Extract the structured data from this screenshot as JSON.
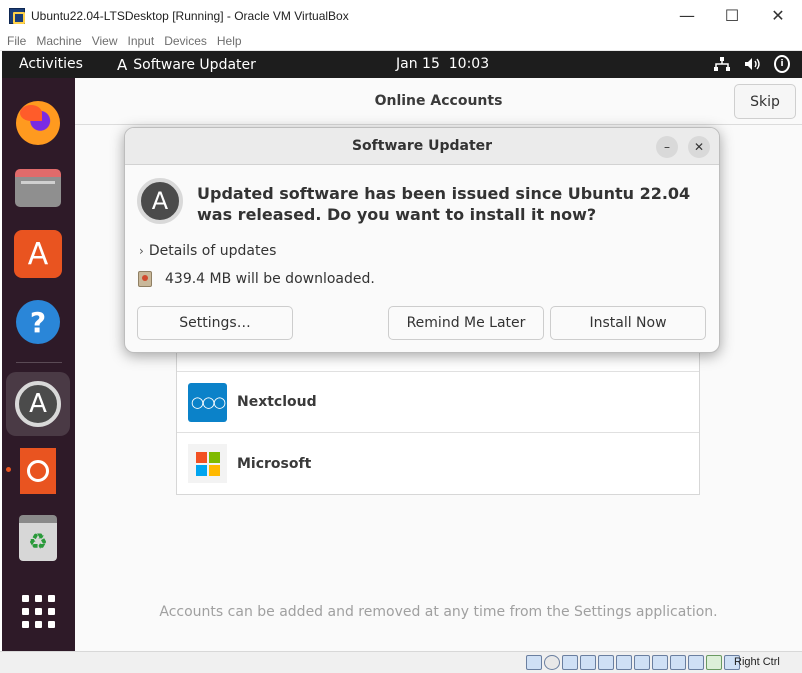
{
  "host": {
    "window_title": "Ubuntu22.04-LTSDesktop [Running] - Oracle VM VirtualBox",
    "controls": {
      "minimize": "—",
      "maximize": "☐",
      "close": "✕"
    },
    "menu": [
      "File",
      "Machine",
      "View",
      "Input",
      "Devices",
      "Help"
    ],
    "status_host_key": "Right Ctrl"
  },
  "topbar": {
    "activities": "Activities",
    "app_name": "Software Updater",
    "app_glyph": "A",
    "date": "Jan 15",
    "time": "10:03",
    "tray": [
      "network-icon",
      "volume-icon",
      "accessibility-icon"
    ]
  },
  "dock": {
    "items": [
      "firefox-icon",
      "files-icon",
      "app-center-icon",
      "help-icon",
      "software-updater-icon",
      "ubuntu-icon",
      "trash-icon",
      "show-apps-icon"
    ],
    "glyphs": {
      "app_center": "A",
      "help": "?",
      "updater": "A",
      "trash": "♻"
    }
  },
  "online_accounts": {
    "title": "Online Accounts",
    "skip": "Skip",
    "providers": [
      "Nextcloud",
      "Microsoft"
    ],
    "nextcloud_glyph": "○○○",
    "footer": "Accounts can be added and removed at any time from the Settings application.",
    "colors": {
      "nextcloud": "#0b82c9",
      "ms_red": "#f25022",
      "ms_green": "#7fba00",
      "ms_blue": "#00a4ef",
      "ms_yellow": "#ffb900"
    }
  },
  "dialog": {
    "title": "Software Updater",
    "min": "–",
    "close": "✕",
    "icon_glyph": "A",
    "heading": "Updated software has been issued since Ubuntu 22.04 was released. Do you want to install it now?",
    "details_chevron": "›",
    "details": "Details of updates",
    "download": "439.4 MB will be downloaded.",
    "buttons": {
      "settings": "Settings…",
      "remind": "Remind Me Later",
      "install": "Install Now"
    }
  },
  "colors": {
    "accent": "#e95420",
    "dock_bg": "#2e1a28",
    "topbar_bg": "#1d1d1d"
  }
}
